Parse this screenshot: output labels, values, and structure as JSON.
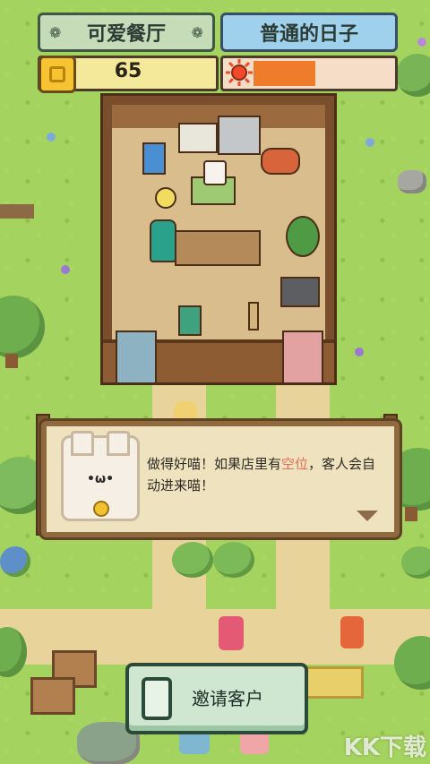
{
  "header": {
    "restaurant_name": "可爱餐厅",
    "day_label": "普通的日子"
  },
  "stats": {
    "coins": "65",
    "sun_level": 0.45
  },
  "dialog": {
    "text_before": "做得好喵！如果店里有",
    "highlight": "空位",
    "text_after": "，客人会自动进来喵！"
  },
  "actions": {
    "invite_label": "邀请客户"
  },
  "watermark": "KK下载",
  "colors": {
    "coin_bar": "#f4e89a",
    "sun_fill": "#ef7c2a",
    "highlight_text": "#e56b5b",
    "button_bg": "#cfe7d0"
  },
  "icons": [
    "paw-icon",
    "coin-icon",
    "sun-icon",
    "next-arrow-icon",
    "invite-icon"
  ]
}
